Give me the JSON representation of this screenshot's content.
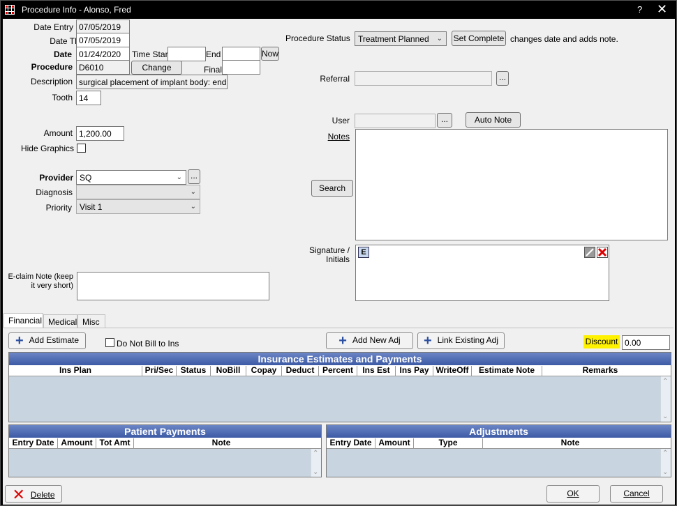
{
  "window": {
    "title": "Procedure Info - Alonso, Fred",
    "help_label": "?",
    "close_label": "✕"
  },
  "left": {
    "date_entry_label": "Date Entry",
    "date_entry": "07/05/2019",
    "date_tp_label": "Date TP",
    "date_tp": "07/05/2019",
    "date_label": "Date",
    "date": "01/24/2020",
    "time_start_label": "Time Start",
    "time_start": "",
    "end_label": "End",
    "end": "",
    "now_label": "Now",
    "procedure_label": "Procedure",
    "procedure": "D6010",
    "change_label": "Change",
    "final_label": "Final",
    "final": "",
    "description_label": "Description",
    "description": "surgical placement of implant body: endosteal",
    "tooth_label": "Tooth",
    "tooth": "14",
    "amount_label": "Amount",
    "amount": "1,200.00",
    "hide_graphics_label": "Hide Graphics",
    "provider_label": "Provider",
    "provider": "SQ",
    "provider_more": "...",
    "diagnosis_label": "Diagnosis",
    "diagnosis": "",
    "priority_label": "Priority",
    "priority": "Visit 1",
    "eclaim_label": "E-claim Note (keep it very short)",
    "eclaim": ""
  },
  "right": {
    "status_label": "Procedure Status",
    "status": "Treatment Planned",
    "set_complete_label": "Set Complete",
    "set_complete_note": "changes date and adds note.",
    "referral_label": "Referral",
    "referral": "",
    "referral_more": "...",
    "user_label": "User",
    "user": "",
    "user_more": "...",
    "auto_note_label": "Auto Note",
    "notes_label": "Notes",
    "notes": "",
    "search_label": "Search",
    "signature_label": "Signature / Initials",
    "sig_e_label": "E"
  },
  "tabs": [
    {
      "label": "Financial"
    },
    {
      "label": "Medical"
    },
    {
      "label": "Misc"
    }
  ],
  "financial": {
    "add_estimate_label": "Add Estimate",
    "do_not_bill_label": "Do Not Bill to Ins",
    "add_new_adj_label": "Add New Adj",
    "link_existing_adj_label": "Link Existing Adj",
    "discount_label": "Discount",
    "discount": "0.00",
    "ins_grid": {
      "title": "Insurance Estimates and Payments",
      "columns": [
        "Ins Plan",
        "Pri/Sec",
        "Status",
        "NoBill",
        "Copay",
        "Deduct",
        "Percent",
        "Ins Est",
        "Ins Pay",
        "WriteOff",
        "Estimate Note",
        "Remarks"
      ]
    },
    "pay_grid": {
      "title": "Patient Payments",
      "columns": [
        "Entry Date",
        "Amount",
        "Tot Amt",
        "Note"
      ]
    },
    "adj_grid": {
      "title": "Adjustments",
      "columns": [
        "Entry Date",
        "Amount",
        "Type",
        "Note"
      ]
    }
  },
  "footer": {
    "delete_label": "Delete",
    "ok_label": "OK",
    "cancel_label": "Cancel"
  },
  "colors": {
    "highlight": "#fff200",
    "grid_header": "#3c5aa5",
    "delete_icon": "#dd0000"
  }
}
